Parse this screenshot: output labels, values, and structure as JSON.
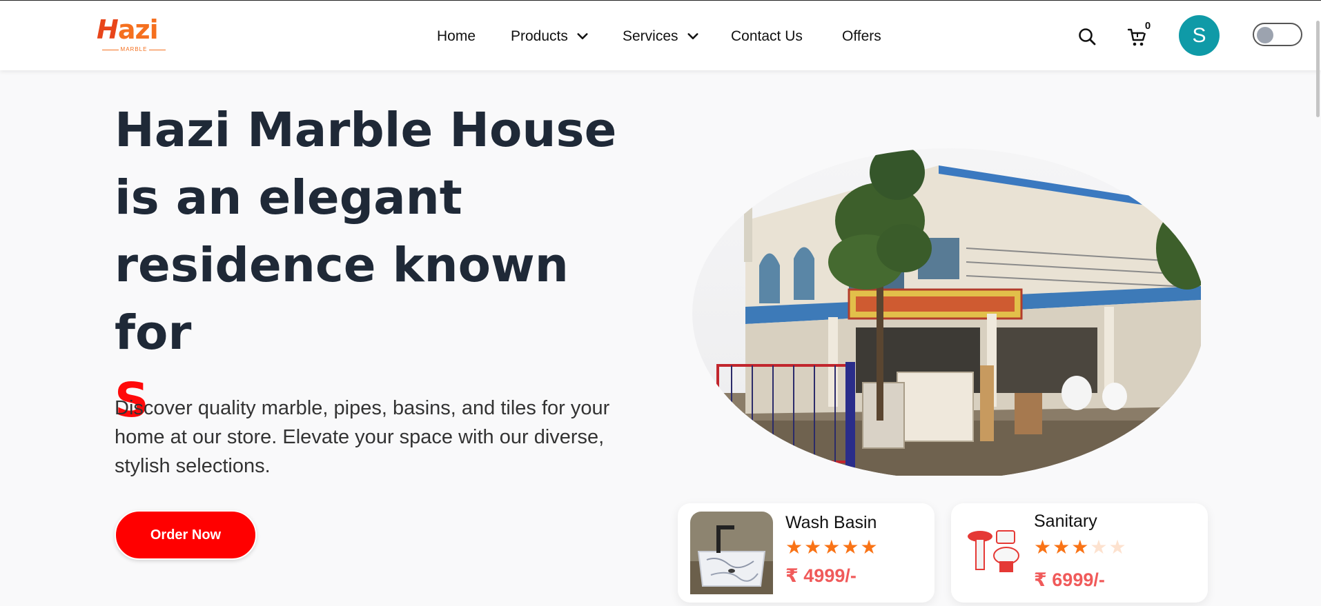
{
  "brand": {
    "logo_text": "Hazi",
    "logo_sub": "MARBLE"
  },
  "nav": {
    "home": "Home",
    "products": "Products",
    "services": "Services",
    "contact": "Contact Us",
    "offers": "Offers"
  },
  "header": {
    "cart_count": "0",
    "avatar_initial": "S"
  },
  "hero": {
    "title": "Hazi Marble House is an elegant residence known for",
    "typed_text": "S",
    "description": "Discover quality marble, pipes, basins, and tiles for your home at our store. Elevate your space with our diverse, stylish selections.",
    "cta_label": "Order Now"
  },
  "products": [
    {
      "name": "Wash Basin",
      "rating": 5,
      "max_rating": 5,
      "price": "₹ 4999/-"
    },
    {
      "name": "Sanitary",
      "rating": 3,
      "max_rating": 5,
      "price": "₹ 6999/-"
    }
  ],
  "colors": {
    "accent": "#ff0000",
    "avatar": "#0f9aa7",
    "star": "#f97316",
    "price": "#f05a5a",
    "logo": "#f5701f"
  }
}
